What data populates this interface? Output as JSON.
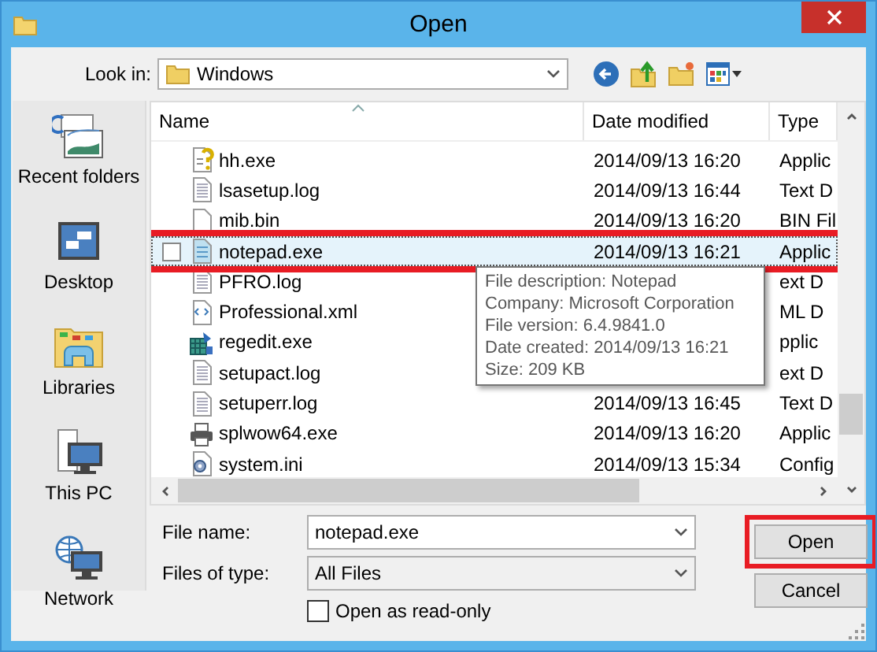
{
  "window": {
    "title": "Open"
  },
  "look_in": {
    "label": "Look in:",
    "value": "Windows"
  },
  "places": [
    {
      "kind": "recent",
      "label": "Recent folders"
    },
    {
      "kind": "desktop",
      "label": "Desktop"
    },
    {
      "kind": "libraries",
      "label": "Libraries"
    },
    {
      "kind": "pc",
      "label": "This PC"
    },
    {
      "kind": "network",
      "label": "Network"
    }
  ],
  "table": {
    "columns": [
      "Name",
      "Date modified",
      "Type"
    ],
    "rows": [
      {
        "kind": "help-app",
        "name": "hh.exe",
        "date": "2014/09/13 16:20",
        "type": "Applic",
        "selected": false,
        "highlighted": false
      },
      {
        "kind": "text",
        "name": "lsasetup.log",
        "date": "2014/09/13 16:44",
        "type": "Text D",
        "selected": false,
        "highlighted": false
      },
      {
        "kind": "file",
        "name": "mib.bin",
        "date": "2014/09/13 16:20",
        "type": "BIN Fil",
        "selected": false,
        "highlighted": false
      },
      {
        "kind": "app",
        "name": "notepad.exe",
        "date": "2014/09/13 16:21",
        "type": "Applic",
        "selected": true,
        "highlighted": true
      },
      {
        "kind": "text",
        "name": "PFRO.log",
        "type": "ext D",
        "selected": false,
        "highlighted": false
      },
      {
        "kind": "xml",
        "name": "Professional.xml",
        "type": "ML D",
        "selected": false,
        "highlighted": false
      },
      {
        "kind": "registry",
        "name": "regedit.exe",
        "type": "pplic",
        "selected": false,
        "highlighted": false
      },
      {
        "kind": "text",
        "name": "setupact.log",
        "type": "ext D",
        "selected": false,
        "highlighted": false
      },
      {
        "kind": "text",
        "name": "setuperr.log",
        "date": "2014/09/13 16:45",
        "type": "Text D",
        "selected": false,
        "highlighted": false
      },
      {
        "kind": "printer",
        "name": "splwow64.exe",
        "date": "2014/09/13 16:20",
        "type": "Applic",
        "selected": false,
        "highlighted": false
      },
      {
        "kind": "settings",
        "name": "system.ini",
        "date": "2014/09/13 15:34",
        "type": "Config",
        "selected": false,
        "highlighted": false
      }
    ]
  },
  "tooltip": [
    "File description: Notepad",
    "Company: Microsoft Corporation",
    "File version: 6.4.9841.0",
    "Date created: 2014/09/13 16:21",
    "Size: 209 KB"
  ],
  "file_name": {
    "label": "File name:",
    "value": "notepad.exe"
  },
  "file_type": {
    "label": "Files of type:",
    "value": "All Files"
  },
  "read_only": {
    "label": "Open as read-only",
    "checked": false
  },
  "buttons": [
    {
      "label": "Open",
      "highlighted": true
    },
    {
      "label": "Cancel",
      "highlighted": false
    }
  ]
}
